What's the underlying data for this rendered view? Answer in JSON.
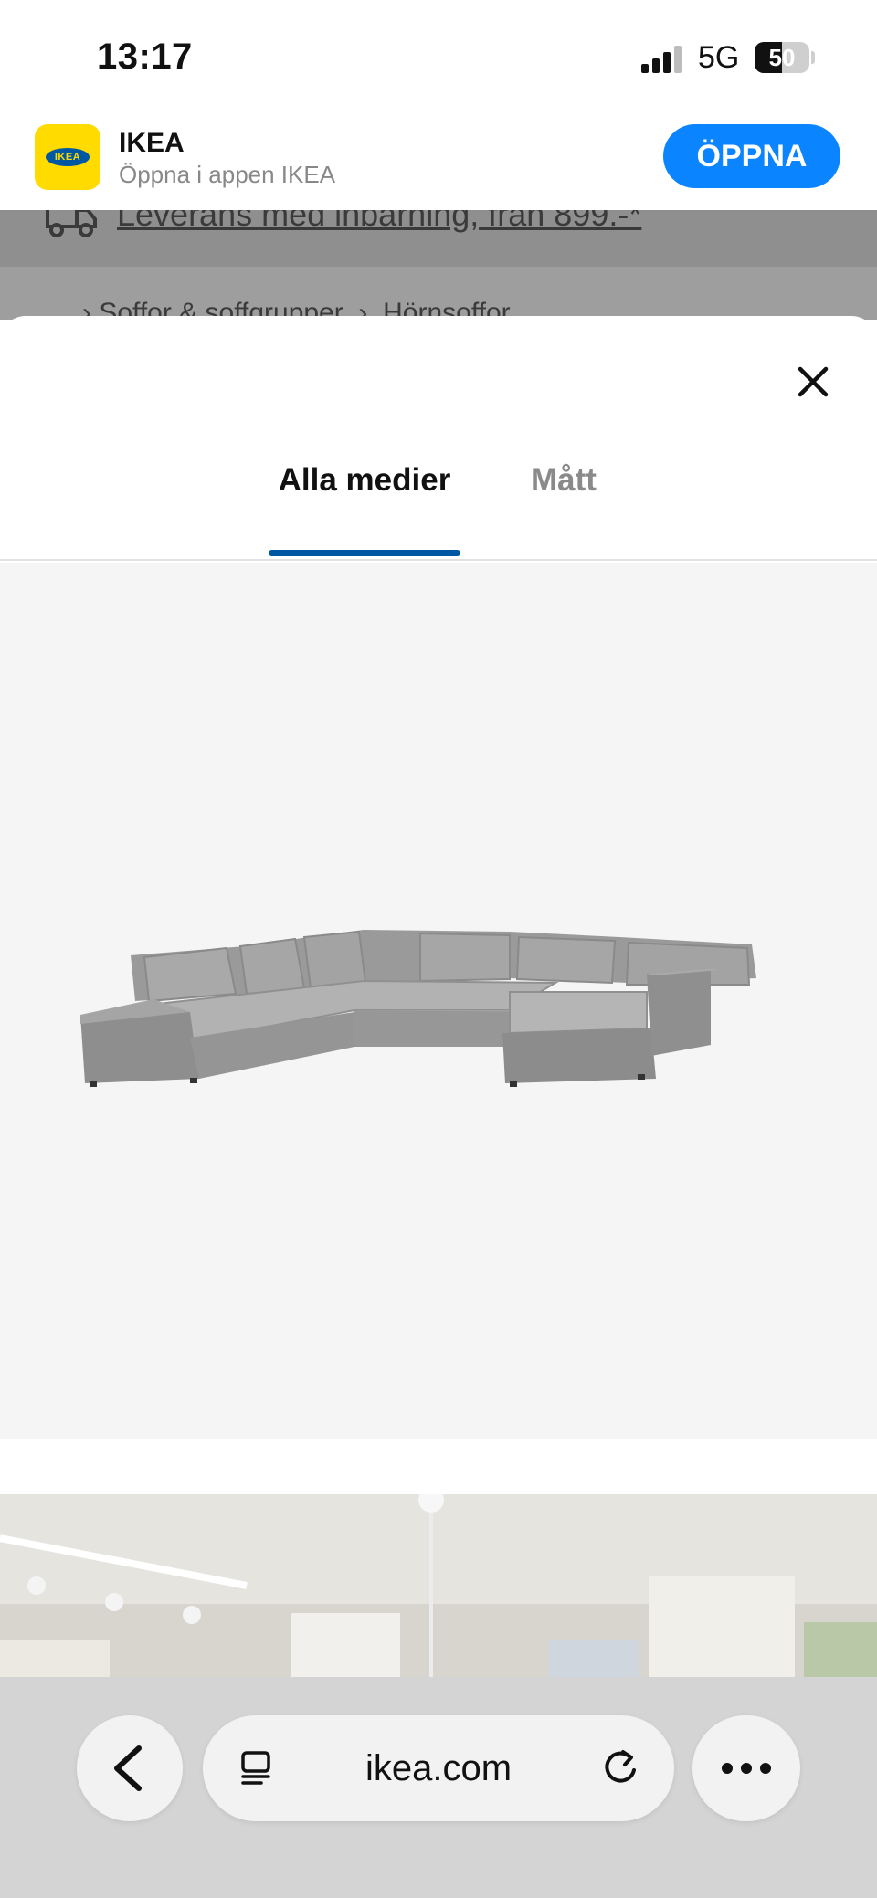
{
  "status_bar": {
    "time": "13:17",
    "network": "5G",
    "battery": "50",
    "battery_level": 0.5
  },
  "app_banner": {
    "name": "IKEA",
    "subtitle": "Öppna i appen IKEA",
    "logo_text": "IKEA",
    "open_label": "ÖPPNA",
    "accent": "#0a84ff"
  },
  "background_page": {
    "delivery_text": "Leverans med inbärning, från 899.-*",
    "breadcrumb": [
      "Soffor & soffgrupper",
      "Hörnsoffor"
    ]
  },
  "media_sheet": {
    "tabs": [
      {
        "label": "Alla medier",
        "selected": true
      },
      {
        "label": "Mått",
        "selected": false
      }
    ],
    "accent": "#0058A3"
  },
  "browser": {
    "url": "ikea.com",
    "icons": [
      "back-icon",
      "reader-icon",
      "reload-icon",
      "more-icon"
    ]
  }
}
